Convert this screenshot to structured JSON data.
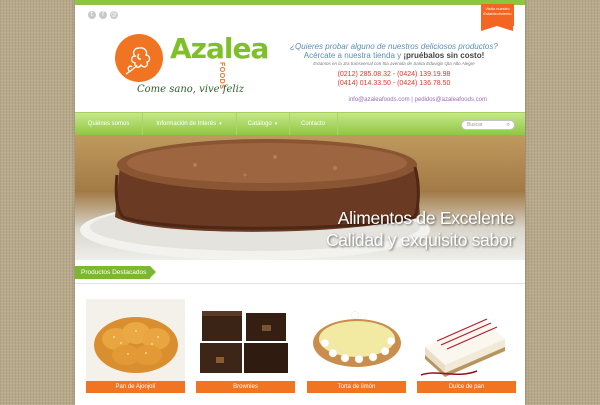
{
  "header": {
    "social_icons": [
      "twitter-icon",
      "facebook-icon",
      "email-icon"
    ],
    "ribbon": "Visita nuestro Establecimiento",
    "brand": {
      "name": "Azalea",
      "sub": "FOODS",
      "tagline": "Come sano, vive feliz"
    },
    "promo": {
      "question": "¿Quieres probar alguno de nuestros deliciosos productos?",
      "action_pre": "Acércate a nuestra tienda y ",
      "action_bold": "¡pruébalos sin costo!",
      "address": "Estamos en la 3ra transversal con 5ta avenida de Santa Eduvigis Qta Alto Alegre",
      "phone1": "(0212) 285.08.32 - (0424) 139.19.98",
      "phone2": "(0414) 014.33.50 - (0424) 136.78.50"
    },
    "emails": "info@azaleafoods.com | pedidos@azaleafoods.com"
  },
  "nav": {
    "items": [
      "Quiénes somos",
      "Información de Interés",
      "Catálogo",
      "Contacto"
    ],
    "search_placeholder": "Buscar"
  },
  "hero": {
    "line1": "Alimentos de Excelente",
    "line2": "Calidad y exquisito sabor"
  },
  "products": {
    "title": "Productos Destacados",
    "items": [
      {
        "label": "Pan de Ajonjolí"
      },
      {
        "label": "Brownies"
      },
      {
        "label": "Torta de limón"
      },
      {
        "label": "Dulce de pan"
      }
    ]
  },
  "colors": {
    "accent_green": "#8cc63f",
    "accent_orange": "#f07422",
    "phone_red": "#e0362c"
  }
}
